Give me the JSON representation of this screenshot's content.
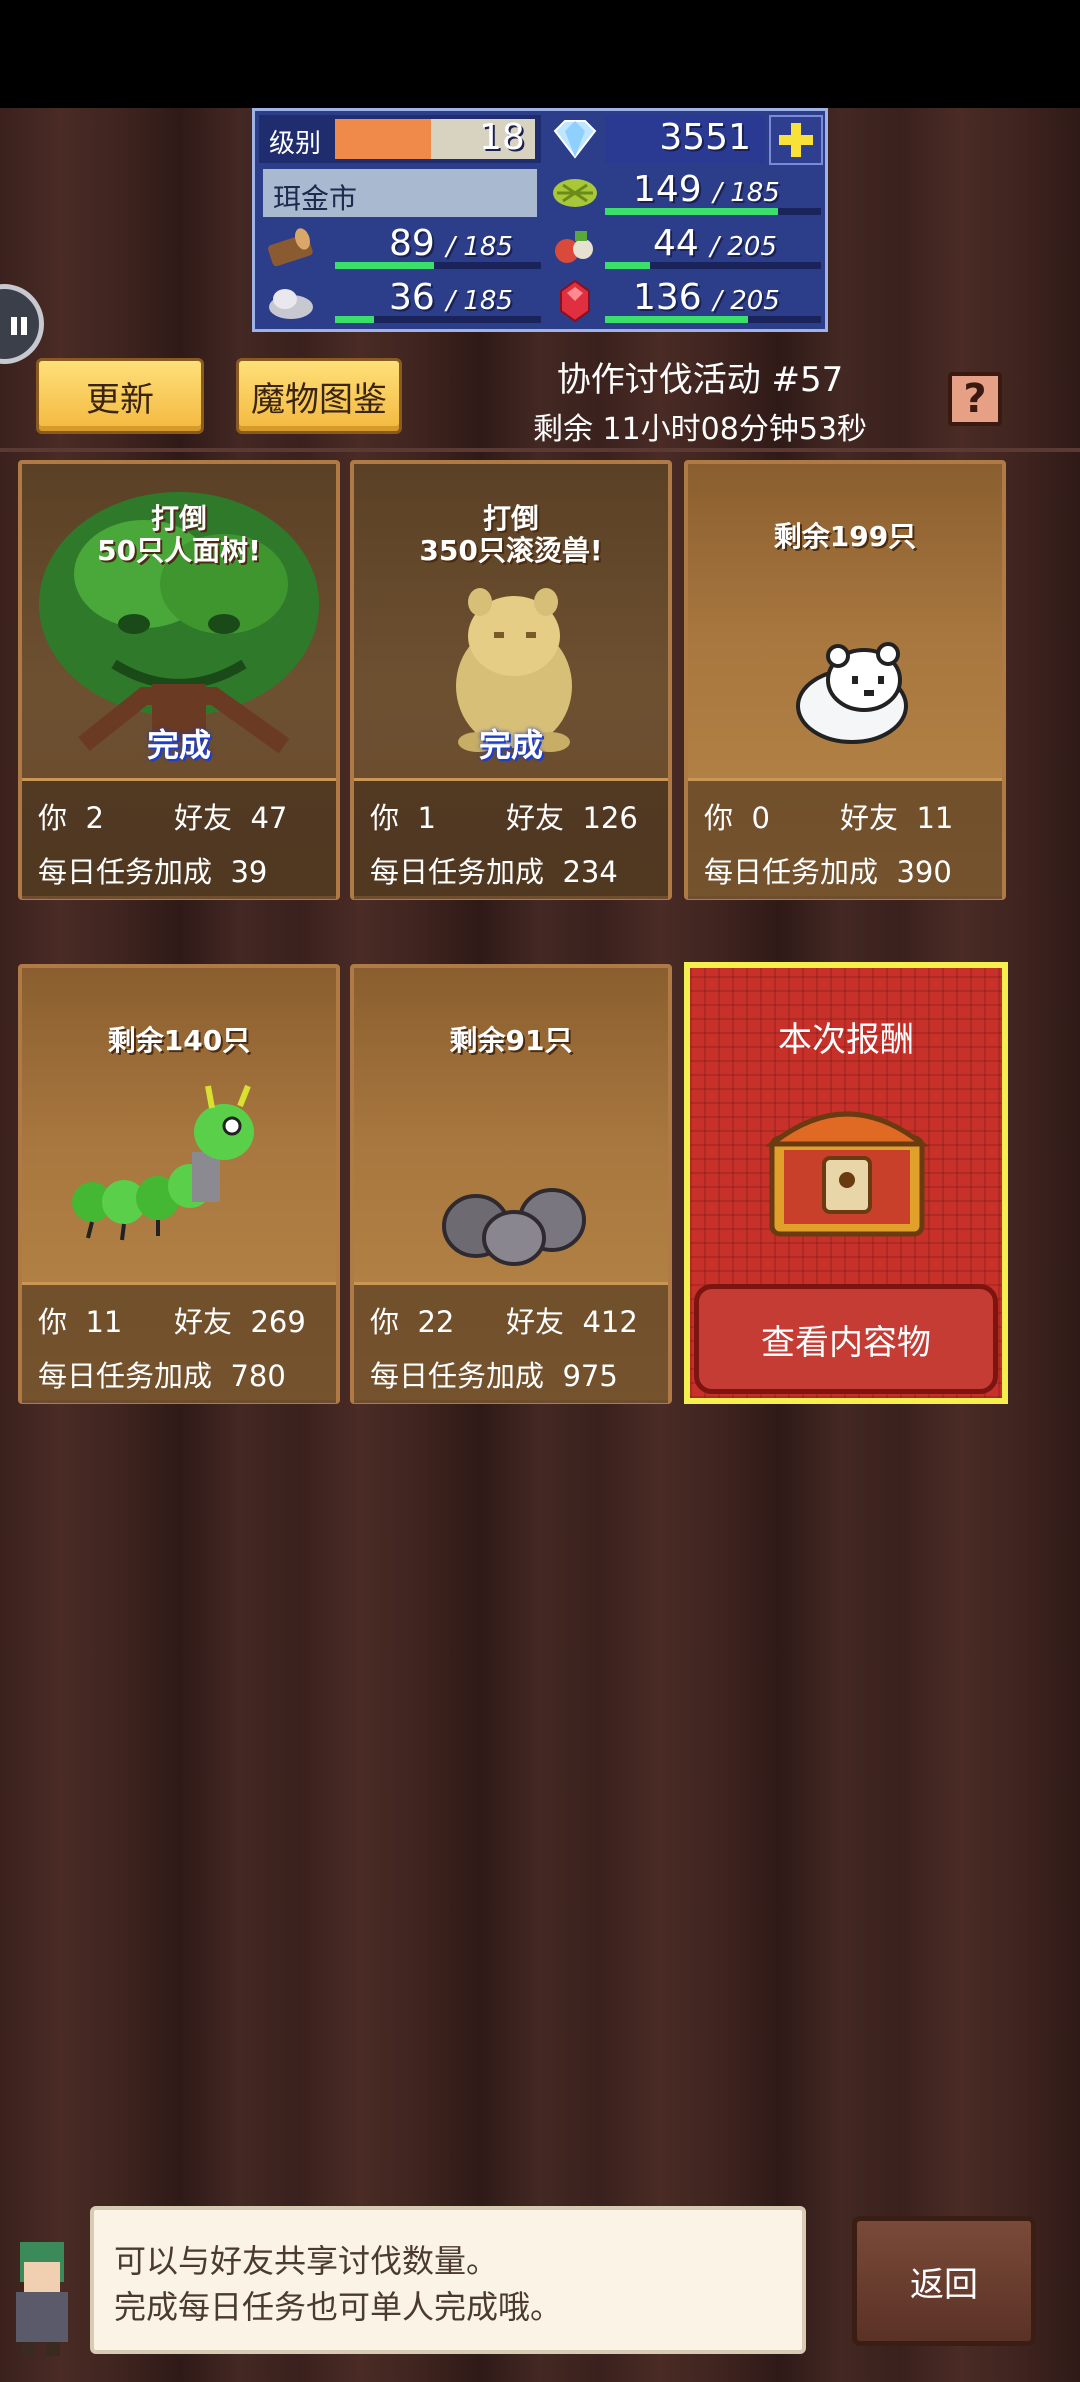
{
  "resources": {
    "level_label": "级别",
    "level_value": "18",
    "level_progress": 0.48,
    "gems": "3551",
    "town_name": "珥金市",
    "items": [
      {
        "name": "grass",
        "value": "149",
        "max": "185",
        "progress": 0.8
      },
      {
        "name": "wood",
        "value": "89",
        "max": "185",
        "progress": 0.48
      },
      {
        "name": "food",
        "value": "44",
        "max": "205",
        "progress": 0.21
      },
      {
        "name": "ore",
        "value": "36",
        "max": "185",
        "progress": 0.19
      },
      {
        "name": "ruby",
        "value": "136",
        "max": "205",
        "progress": 0.66
      }
    ],
    "slash": "/"
  },
  "header": {
    "refresh_label": "更新",
    "bestiary_label": "魔物图鉴",
    "event_title": "协作讨伐活动 #57",
    "event_timer": "剩余 11小时08分钟53秒",
    "help_label": "?"
  },
  "labels": {
    "you": "你",
    "friend": "好友",
    "daily_bonus": "每日任务加成",
    "done": "完成"
  },
  "cards": [
    {
      "title_line1": "打倒",
      "title_line2": "50只人面树!",
      "you": "2",
      "friends": "47",
      "bonus": "39"
    },
    {
      "title_line1": "打倒",
      "title_line2": "350只滚烫兽!",
      "you": "1",
      "friends": "126",
      "bonus": "234"
    },
    {
      "remaining": "剩余199只",
      "you": "0",
      "friends": "11",
      "bonus": "390"
    },
    {
      "remaining": "剩余140只",
      "you": "11",
      "friends": "269",
      "bonus": "780"
    },
    {
      "remaining": "剩余91只",
      "you": "22",
      "friends": "412",
      "bonus": "975"
    }
  ],
  "reward": {
    "title": "本次报酬",
    "view_label": "查看内容物"
  },
  "message": {
    "line1": "可以与好友共享讨伐数量。",
    "line2": "完成每日任务也可单人完成哦。"
  },
  "back_label": "返回"
}
